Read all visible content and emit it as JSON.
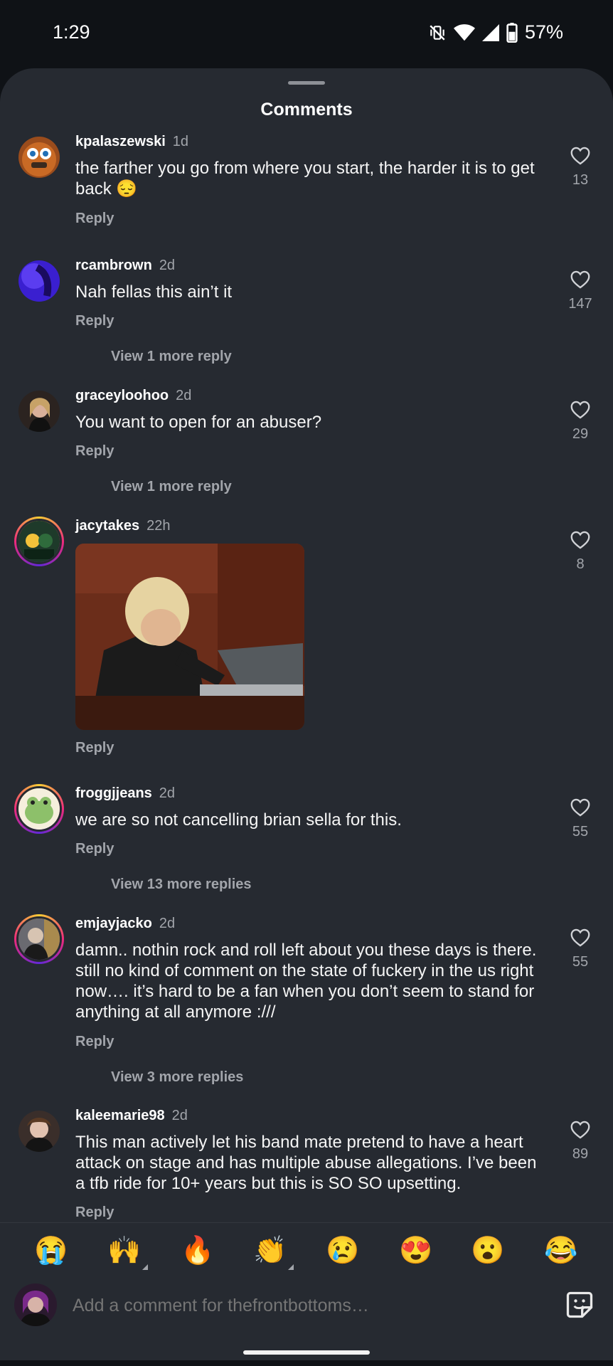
{
  "status_bar": {
    "time": "1:29",
    "battery": "57%"
  },
  "sheet": {
    "title": "Comments"
  },
  "comments": [
    {
      "username": "kpalaszewski",
      "time": "1d",
      "text": "the farther you go from where you start, the harder it is to get back 😔",
      "reply_label": "Reply",
      "likes": "13"
    },
    {
      "username": "rcambrown",
      "time": "2d",
      "text": "Nah fellas this ain’t it",
      "reply_label": "Reply",
      "likes": "147",
      "more_replies": "View 1 more reply"
    },
    {
      "username": "graceyloohoo",
      "time": "2d",
      "text": "You want to open for an abuser?",
      "reply_label": "Reply",
      "likes": "29",
      "more_replies": "View 1 more reply"
    },
    {
      "username": "jacytakes",
      "time": "22h",
      "reply_label": "Reply",
      "likes": "8"
    },
    {
      "username": "froggjjeans",
      "time": "2d",
      "text": "we are so not cancelling brian sella for this.",
      "reply_label": "Reply",
      "likes": "55",
      "more_replies": "View 13 more replies"
    },
    {
      "username": "emjayjacko",
      "time": "2d",
      "text": "damn.. nothin rock and roll left about you these days is there. still no kind of comment on the state of fuckery in the us right now…. it’s hard to be a fan when you don’t seem to stand for anything at all anymore :///",
      "reply_label": "Reply",
      "likes": "55",
      "more_replies": "View 3 more replies"
    },
    {
      "username": "kaleemarie98",
      "time": "2d",
      "text": "This man actively let his band mate pretend to have a heart attack on stage and has multiple abuse allegations. I’ve been a tfb ride for 10+ years but this is SO SO upsetting.",
      "reply_label": "Reply",
      "likes": "89"
    }
  ],
  "emoji_bar": [
    "😭",
    "🙌",
    "🔥",
    "👏",
    "😢",
    "😍",
    "😮",
    "😂"
  ],
  "comment_input": {
    "placeholder": "Add a comment for thefrontbottoms…"
  },
  "icons": {
    "like": "heart-outline-icon",
    "sticker": "sticker-icon",
    "wifi": "wifi-icon",
    "signal": "signal-icon",
    "mute": "vibrate-off-icon",
    "battery": "battery-icon"
  },
  "colors": {
    "sheet_bg": "#262a31",
    "background": "#0f1216",
    "muted_text": "#a2a5ab"
  }
}
